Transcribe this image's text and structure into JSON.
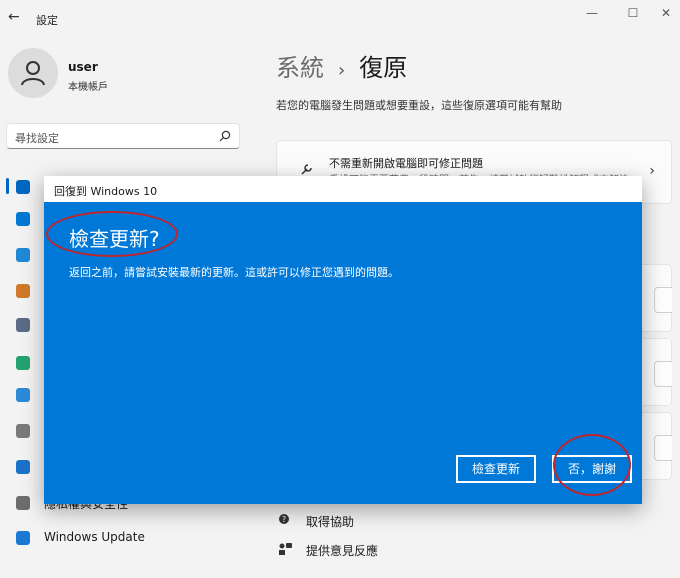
{
  "window": {
    "title": "設定",
    "back_glyph": "←",
    "minimize": "—",
    "maximize": "☐",
    "close": "✕"
  },
  "user": {
    "name": "user",
    "account_type": "本機帳戶"
  },
  "search": {
    "placeholder": "尋找設定"
  },
  "sidebar": {
    "items": [
      {
        "icon": "display-icon",
        "color": "#0067c0",
        "label": ""
      },
      {
        "icon": "bluetooth-icon",
        "color": "#0078d4",
        "label": ""
      },
      {
        "icon": "wifi-icon",
        "color": "#1f89d6",
        "label": ""
      },
      {
        "icon": "brush-icon",
        "color": "#d07a2a",
        "label": ""
      },
      {
        "icon": "apps-icon",
        "color": "#5a6b85",
        "label": ""
      },
      {
        "icon": "accounts-icon",
        "color": "#25a36f",
        "label": ""
      },
      {
        "icon": "time-language-icon",
        "color": "#2c8ad6",
        "label": ""
      },
      {
        "icon": "gaming-icon",
        "color": "#7a7a7a",
        "label": ""
      },
      {
        "icon": "accessibility-icon",
        "color": "#1a73c8",
        "label": ""
      },
      {
        "icon": "privacy-security-icon",
        "color": "#6d6d6d",
        "label": "隱私權與安全性"
      },
      {
        "icon": "windows-update-icon",
        "color": "#1a7ad1",
        "label": "Windows Update"
      }
    ]
  },
  "main": {
    "breadcrumb_parent": "系統",
    "breadcrumb_sep": "›",
    "breadcrumb_current": "復原",
    "subtitle": "若您的電腦發生問題或想要重設，這些復原選項可能有幫助",
    "fix_card": {
      "title": "不需重新開啟電腦即可修正問題",
      "description": "重設可能需要花費一段時間，首先，請嘗試執行疑難排解程式來解決",
      "chevron": "›"
    },
    "links": [
      {
        "icon": "help-icon",
        "label": "取得協助"
      },
      {
        "icon": "feedback-icon",
        "label": "提供意見反應"
      }
    ]
  },
  "dialog": {
    "title": "回復到 Windows 10",
    "heading": "檢查更新?",
    "body": "返回之前，請嘗試安裝最新的更新。這或許可以修正您遇到的問題。",
    "check_button": "檢查更新",
    "no_button": "否，謝謝",
    "background_color": "#0078d7"
  },
  "annotation_color": "#c0252d"
}
